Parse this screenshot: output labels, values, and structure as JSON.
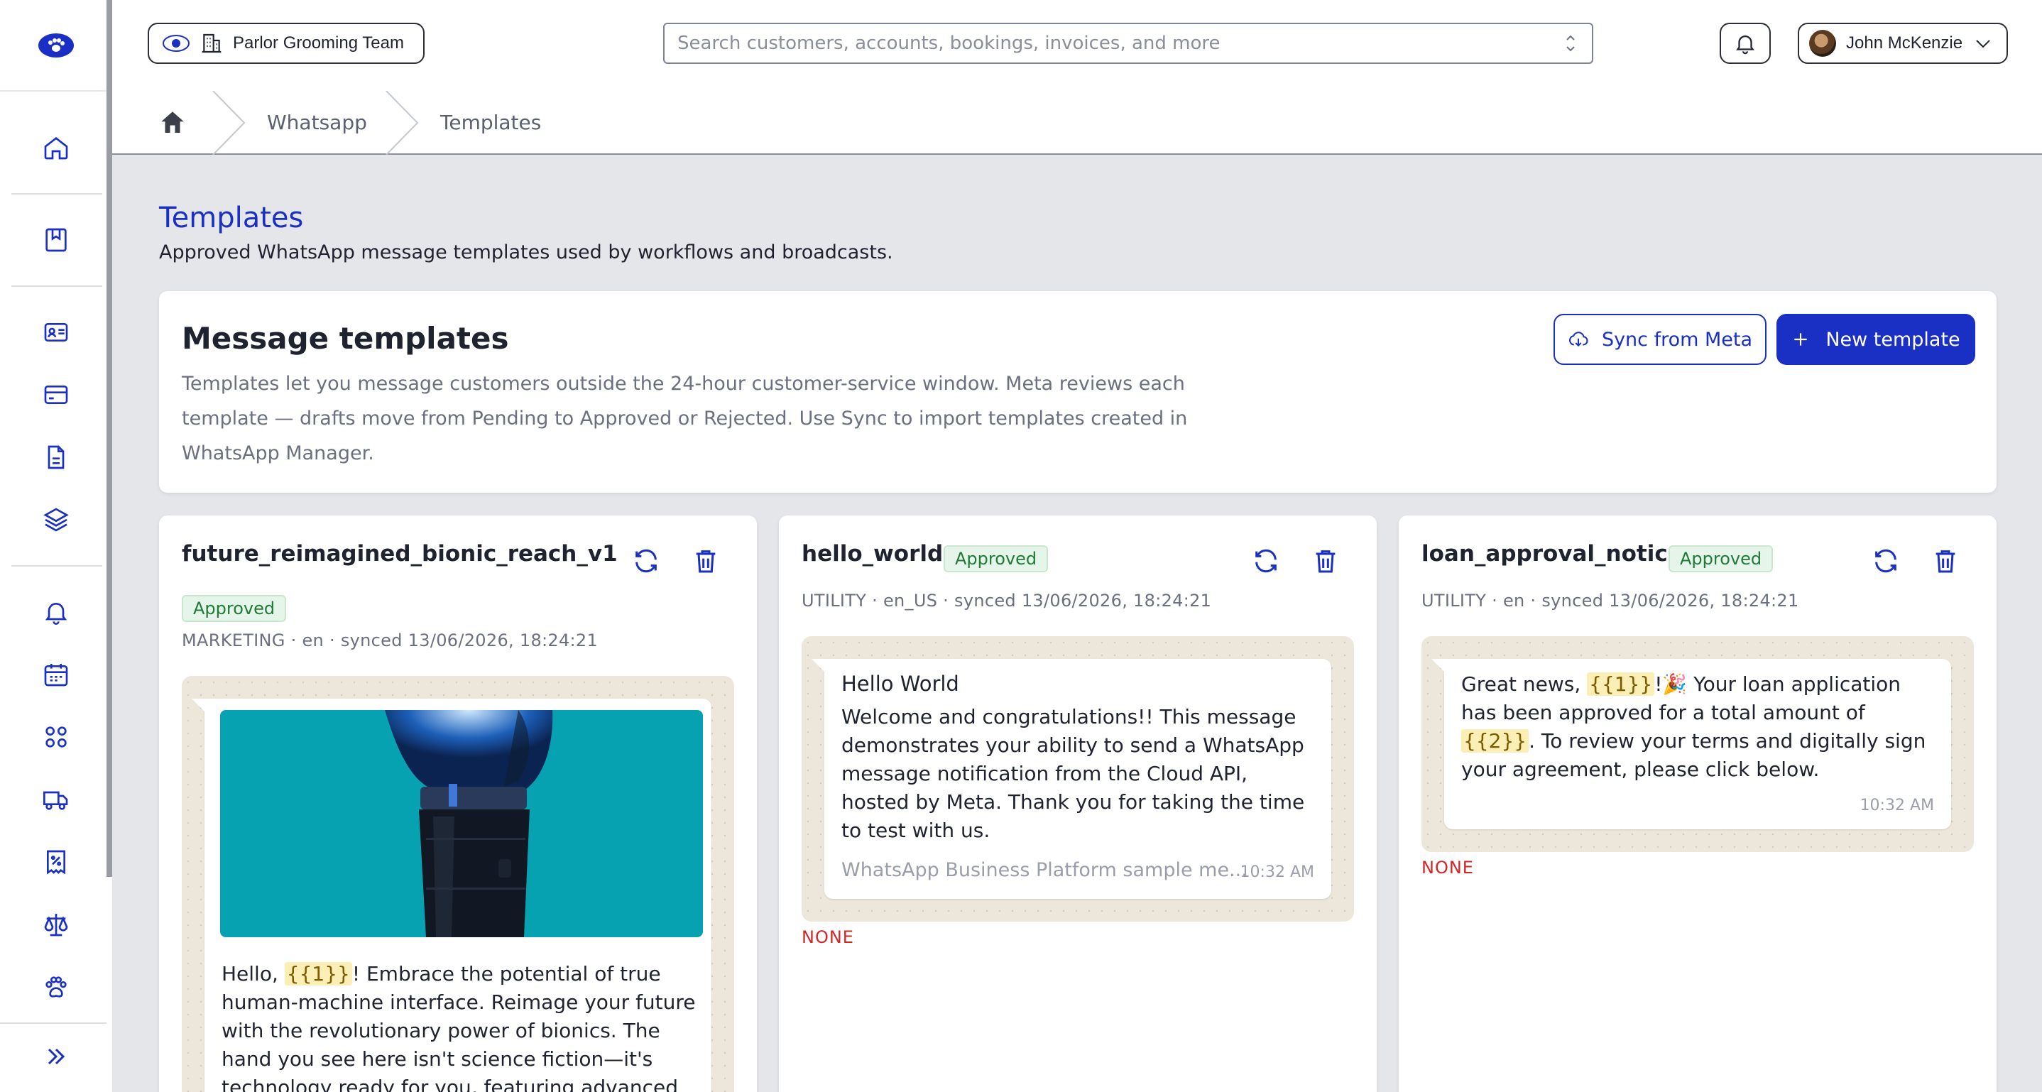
{
  "team": {
    "name": "Parlor Grooming Team"
  },
  "search": {
    "placeholder": "Search customers, accounts, bookings, invoices, and more"
  },
  "user": {
    "name": "John McKenzie"
  },
  "breadcrumb": {
    "items": [
      "Whatsapp",
      "Templates"
    ]
  },
  "page": {
    "title": "Templates",
    "subtitle": "Approved WhatsApp message templates used by workflows and broadcasts."
  },
  "panel": {
    "title": "Message templates",
    "description": "Templates let you message customers outside the 24-hour customer-service window. Meta reviews each template — drafts move from Pending to Approved or Rejected. Use Sync to import templates created in WhatsApp Manager.",
    "sync_label": "Sync from Meta",
    "new_label": "New template"
  },
  "templates": [
    {
      "name": "future_reimagined_bionic_reach_v1",
      "status": "Approved",
      "meta": "MARKETING · en · synced 13/06/2026, 18:24:21",
      "body_pre": "Hello, ",
      "body_var": "{{1}}",
      "body_post": "! Embrace the potential of true human-machine interface. Reimage your future with the revolutionary power of bionics. The hand you see here isn't science fiction—it's technology ready for you, featuring advanced neural control and tactile"
    },
    {
      "name": "hello_world",
      "status": "Approved",
      "meta": "UTILITY · en_US · synced 13/06/2026, 18:24:21",
      "header": "Hello World",
      "body": "Welcome and congratulations!! This message demonstrates your ability to send a WhatsApp message notification from the Cloud API, hosted by Meta. Thank you for taking the time to test with us.",
      "footer": "WhatsApp Business Platform sample me...",
      "time": "10:32 AM",
      "buttons": "NONE"
    },
    {
      "name": "loan_approval_notice",
      "status": "Approved",
      "meta": "UTILITY · en · synced 13/06/2026, 18:24:21",
      "body_a": "Great news, ",
      "var_1": "{{1}}",
      "body_b": "!🎉 Your loan application has been approved for a total amount of ",
      "var_2": "{{2}}",
      "body_c": ". To review your terms and digitally sign your agreement, please click below.",
      "time": "10:32 AM",
      "buttons": "NONE"
    }
  ],
  "icons": {
    "sidebar": [
      "home-icon",
      "bookmark-icon",
      "id-card-icon",
      "credit-card-icon",
      "document-icon",
      "layers-icon",
      "bell-icon",
      "calendar-icon",
      "apps-grid-icon",
      "truck-icon",
      "discount-receipt-icon",
      "scale-icon",
      "paw-icon",
      "expand-icon"
    ],
    "card": [
      "refresh-icon",
      "trash-icon"
    ]
  },
  "colors": {
    "accent": "#1a2fc4",
    "approved_bg": "#e6f5e9",
    "approved_text": "#207a38",
    "none_text": "#d32626"
  }
}
